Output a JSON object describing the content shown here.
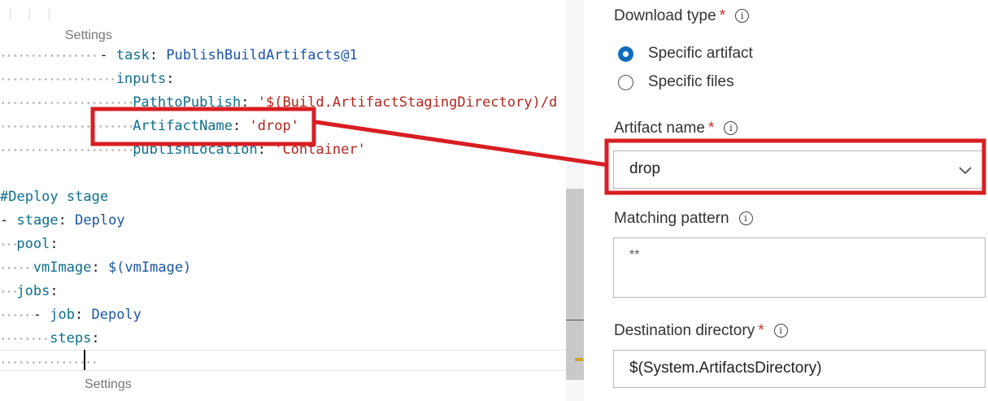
{
  "editor": {
    "codelens_top": "Settings",
    "codelens_bottom": "Settings",
    "lines": [
      {
        "lead": 12,
        "tokens": [
          {
            "t": "- ",
            "c": "p"
          },
          {
            "t": "task",
            "c": "k"
          },
          {
            "t": ": ",
            "c": "p"
          },
          {
            "t": "PublishBuildArtifacts@1",
            "c": "v"
          }
        ]
      },
      {
        "lead": 14,
        "tokens": [
          {
            "t": "inputs",
            "c": "k"
          },
          {
            "t": ":",
            "c": "p"
          }
        ]
      },
      {
        "lead": 16,
        "tokens": [
          {
            "t": "PathtoPublish",
            "c": "k"
          },
          {
            "t": ": ",
            "c": "p"
          },
          {
            "t": "'$(Build.ArtifactStagingDirectory)/d",
            "c": "s"
          }
        ]
      },
      {
        "lead": 16,
        "tokens": [
          {
            "t": "ArtifactName",
            "c": "k"
          },
          {
            "t": ": ",
            "c": "p"
          },
          {
            "t": "'drop'",
            "c": "s"
          }
        ]
      },
      {
        "lead": 16,
        "tokens": [
          {
            "t": "publishLocation",
            "c": "k"
          },
          {
            "t": ": ",
            "c": "p"
          },
          {
            "t": "'Container'",
            "c": "s"
          }
        ]
      },
      {
        "lead": 0,
        "tokens": []
      },
      {
        "lead": 0,
        "tokens": [
          {
            "t": "#Deploy stage",
            "c": "k"
          }
        ]
      },
      {
        "lead": 0,
        "tokens": [
          {
            "t": "- ",
            "c": "p"
          },
          {
            "t": "stage",
            "c": "k"
          },
          {
            "t": ": ",
            "c": "p"
          },
          {
            "t": "Deploy",
            "c": "v"
          }
        ]
      },
      {
        "lead": 2,
        "tokens": [
          {
            "t": "pool",
            "c": "k"
          },
          {
            "t": ":",
            "c": "p"
          }
        ]
      },
      {
        "lead": 4,
        "tokens": [
          {
            "t": "vmImage",
            "c": "k"
          },
          {
            "t": ": ",
            "c": "p"
          },
          {
            "t": "$(vmImage)",
            "c": "v"
          }
        ]
      },
      {
        "lead": 2,
        "tokens": [
          {
            "t": "jobs",
            "c": "k"
          },
          {
            "t": ":",
            "c": "p"
          }
        ]
      },
      {
        "lead": 4,
        "tokens": [
          {
            "t": "- ",
            "c": "p"
          },
          {
            "t": "job",
            "c": "k"
          },
          {
            "t": ": ",
            "c": "p"
          },
          {
            "t": "Depoly",
            "c": "v"
          }
        ]
      },
      {
        "lead": 6,
        "tokens": [
          {
            "t": "steps",
            "c": "k"
          },
          {
            "t": ":",
            "c": "p"
          }
        ]
      },
      {
        "lead": 12,
        "tokens": []
      }
    ]
  },
  "panel": {
    "download_type_label": "Download type",
    "required_mark": "*",
    "info_glyph": "i",
    "radio_options": [
      {
        "label": "Specific artifact",
        "checked": true
      },
      {
        "label": "Specific files",
        "checked": false
      }
    ],
    "artifact_name_label": "Artifact name",
    "artifact_name_value": "drop",
    "matching_pattern_label": "Matching pattern",
    "matching_pattern_value": "**",
    "destination_label": "Destination directory",
    "destination_value": "$(System.ArtifactsDirectory)"
  },
  "colors": {
    "annotation_red": "#d81e23",
    "radio_accent": "#0f6cbd",
    "yaml_key": "#0e6f8e",
    "yaml_value": "#1a56a8",
    "yaml_string": "#b3261e"
  }
}
